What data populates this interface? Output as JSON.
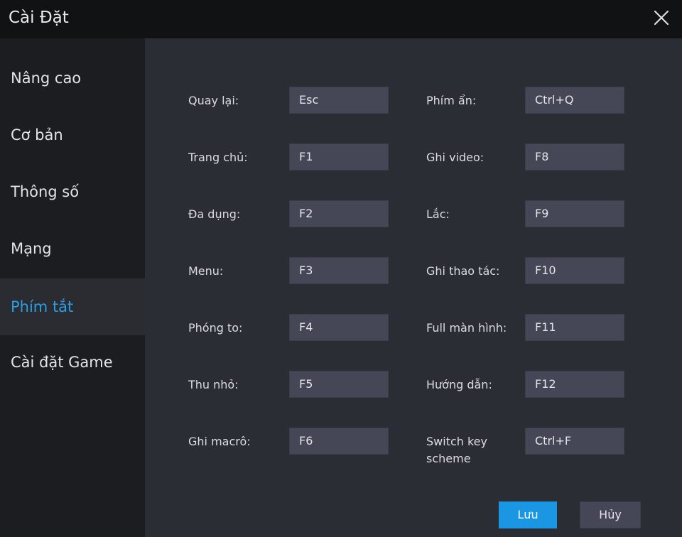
{
  "window": {
    "title": "Cài Đặt"
  },
  "sidebar": {
    "items": [
      {
        "label": "Nâng cao"
      },
      {
        "label": "Cơ bản"
      },
      {
        "label": "Thông số"
      },
      {
        "label": "Mạng"
      },
      {
        "label": "Phím tắt",
        "active": true
      },
      {
        "label": "Cài đặt Game"
      }
    ]
  },
  "shortcuts": {
    "left": [
      {
        "label": "Quay lại:",
        "key": "Esc"
      },
      {
        "label": "Trang chủ:",
        "key": "F1"
      },
      {
        "label": "Đa dụng:",
        "key": "F2"
      },
      {
        "label": "Menu:",
        "key": "F3"
      },
      {
        "label": "Phóng to:",
        "key": "F4"
      },
      {
        "label": "Thu nhỏ:",
        "key": "F5"
      },
      {
        "label": "Ghi macrô:",
        "key": "F6"
      }
    ],
    "right": [
      {
        "label": "Phím ẩn:",
        "key": "Ctrl+Q"
      },
      {
        "label": "Ghi video:",
        "key": "F8"
      },
      {
        "label": "Lắc:",
        "key": "F9"
      },
      {
        "label": "Ghi thao tác:",
        "key": "F10"
      },
      {
        "label": "Full màn hình:",
        "key": "F11"
      },
      {
        "label": "Hướng dẫn:",
        "key": "F12"
      },
      {
        "label": "Switch key scheme",
        "key": "Ctrl+F"
      }
    ]
  },
  "actions": {
    "save_label": "Lưu",
    "cancel_label": "Hủy"
  },
  "icons": {
    "close": "close-icon"
  },
  "colors": {
    "accent": "#1a96e3",
    "active_text": "#2b9ee6"
  }
}
